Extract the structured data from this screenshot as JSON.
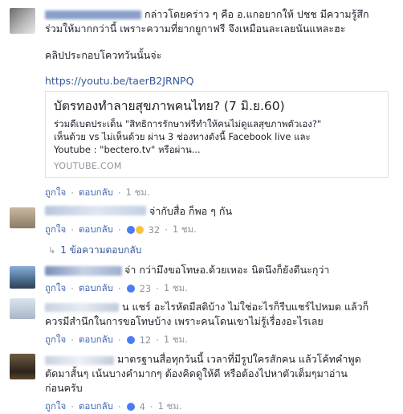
{
  "comment1": {
    "author": "เอกราช ทับทิม",
    "line1": "กล่าวโดยคร่าว ๆ คือ อ.แกอยากให้ ปชช มีความรู้สึก",
    "line2": "ร่วมให้มากกว่านี้ เพราะความที่ยากยูกาฟรี จึงเหมือนละเลยนันแหละฮะ",
    "line3": "คลิปประกอบโควทวันนั้นจ่ะ",
    "url": "https://youtu.be/taerB2JRNPQ",
    "preview": {
      "title": "บัตรทองทำลายสุขภาพคนไทย? (7 มิ.ย.60)",
      "desc1": "ร่วมดีเบตประเด็น \"สิทธิการรักษาฟรีทำให้คนไม่ดูแลสุขภาพตัวเอง?\"",
      "desc2": "เห็นด้วย vs ไม่เห็นด้วย ผ่าน 3 ช่องทางดังนี้ Facebook live และ",
      "desc3": "Youtube : \"bectero.tv\" หรือผ่าน...",
      "domain": "YOUTUBE.COM"
    },
    "actions": {
      "like": "ถูกใจ",
      "reply": "ตอบกลับ",
      "time": "1 ชม."
    }
  },
  "comment2": {
    "line1": "จ่ากับสื่อ ก็พอ ๆ กัน",
    "actions": {
      "like": "ถูกใจ",
      "reply": "ตอบกลับ",
      "count": "32",
      "time": "1 ชม."
    },
    "replies_label": "1 ข้อความตอบกลับ"
  },
  "comment3": {
    "line1": "จ่า กว่ามึงขอโทษอ.ด้วยเหอะ นิดนึงก็ยังดีนะกุว่า",
    "actions": {
      "like": "ถูกใจ",
      "reply": "ตอบกลับ",
      "count": "23",
      "time": "1 ชม."
    }
  },
  "comment4": {
    "line1": "น แชร์ อะไรหัดมีสติบ้าง ไม่ใช่อะไรก็รีบแชร์ไปหมด แล้วก็",
    "line2": "ควรมีสำนึกในการขอโทษบ้าง เพราะคนโดนเขาไม่รู้เรื่องอะไรเลย",
    "actions": {
      "like": "ถูกใจ",
      "reply": "ตอบกลับ",
      "count": "12",
      "time": "1 ชม."
    }
  },
  "comment5": {
    "line1": "มาตรฐานสื่อทุกวันนี้ เวลาที่มีรูปใครสักคน แล้วโค้ทคำพูด",
    "line2": "ตัดมาสั้นๆ เน้นบางคำมากๆ ต้องคิดดูให้ดี หรือต้องไปหาตัวเต็มๆมาอ่าน",
    "line3": "ก่อนครับ",
    "actions": {
      "like": "ถูกใจ",
      "reply": "ตอบกลับ",
      "count": "4",
      "time": "1 ชม."
    }
  },
  "colors": {
    "link": "#365899",
    "action": "#4267b2",
    "meta": "#90949c"
  }
}
